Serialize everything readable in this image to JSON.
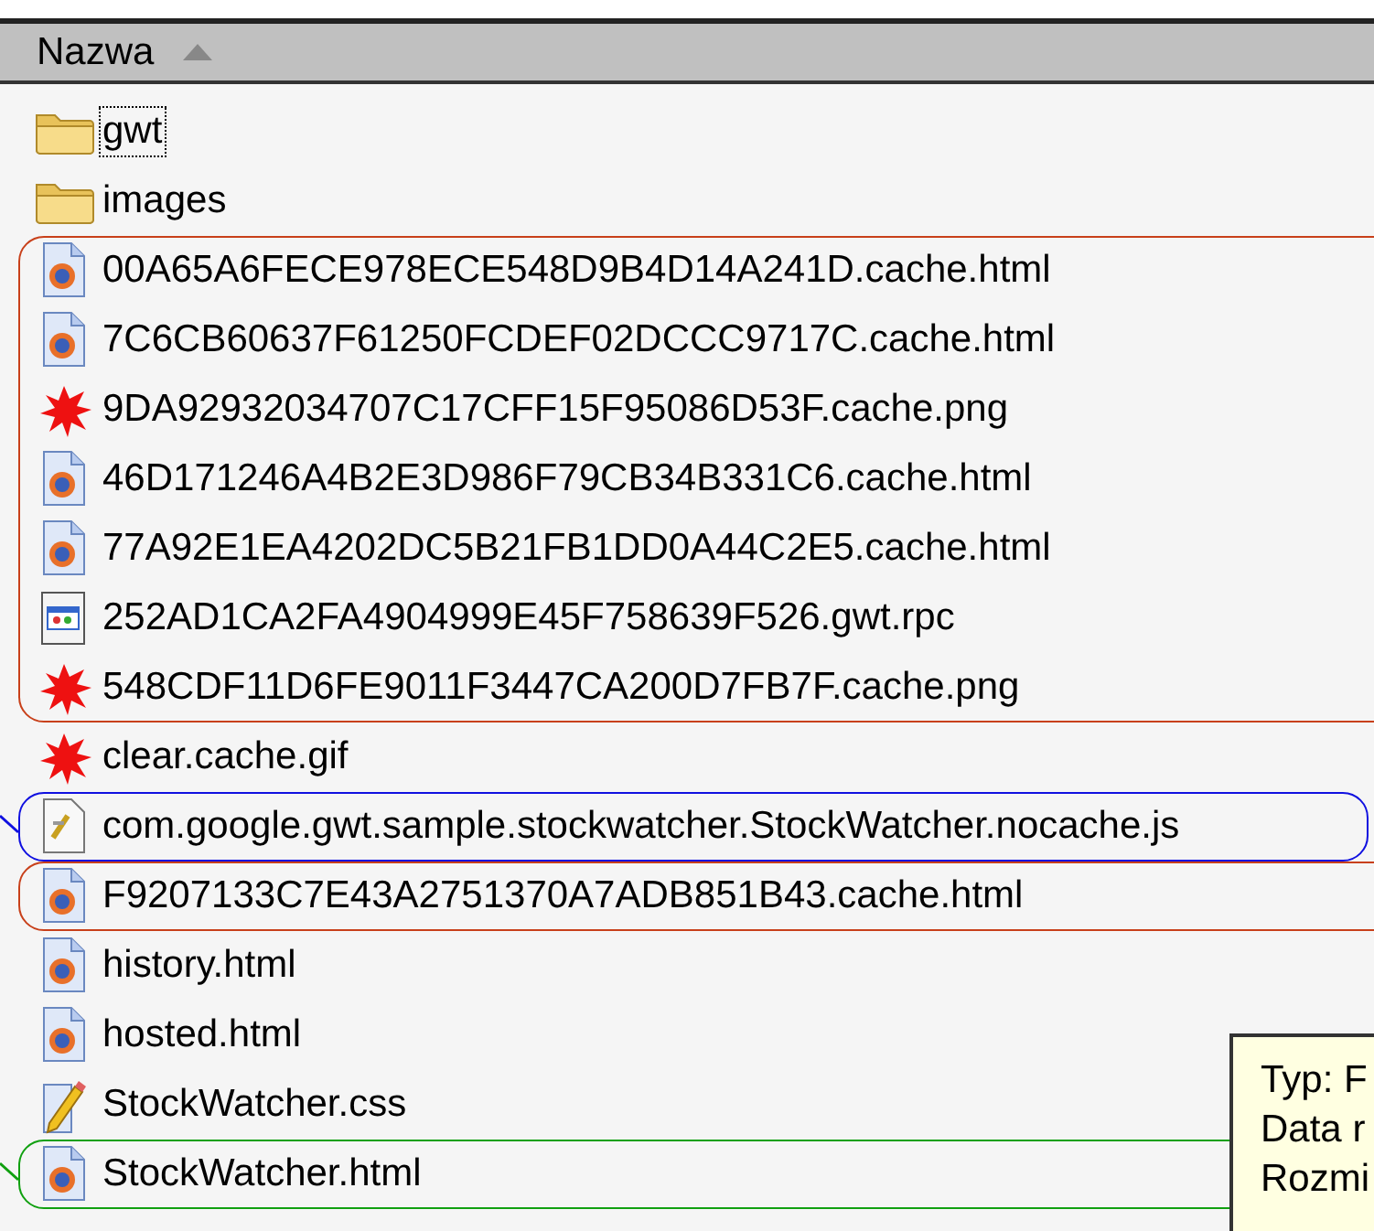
{
  "header": {
    "column": "Nazwa"
  },
  "rows": [
    {
      "kind": "folder",
      "name": "gwt",
      "focused": true
    },
    {
      "kind": "folder",
      "name": "images",
      "focused": false
    },
    {
      "kind": "group",
      "color": "#c8401a",
      "leader": false,
      "open_right": true,
      "children": [
        {
          "kind": "html",
          "name": "00A65A6FECE978ECE548D9B4D14A241D.cache.html",
          "focused": false
        },
        {
          "kind": "html",
          "name": "7C6CB60637F61250FCDEF02DCCC9717C.cache.html",
          "focused": false
        },
        {
          "kind": "image",
          "name": "9DA92932034707C17CFF15F95086D53F.cache.png",
          "focused": false
        },
        {
          "kind": "html",
          "name": "46D171246A4B2E3D986F79CB34B331C6.cache.html",
          "focused": false
        },
        {
          "kind": "html",
          "name": "77A92E1EA4202DC5B21FB1DD0A44C2E5.cache.html",
          "focused": false
        },
        {
          "kind": "rpc",
          "name": "252AD1CA2FA4904999E45F758639F526.gwt.rpc",
          "focused": false
        },
        {
          "kind": "image",
          "name": "548CDF11D6FE9011F3447CA200D7FB7F.cache.png",
          "focused": false
        }
      ]
    },
    {
      "kind": "image",
      "name": "clear.cache.gif",
      "focused": false
    },
    {
      "kind": "group",
      "color": "#1010e0",
      "leader": true,
      "open_right": false,
      "children": [
        {
          "kind": "script",
          "name": "com.google.gwt.sample.stockwatcher.StockWatcher.nocache.js",
          "focused": false
        }
      ]
    },
    {
      "kind": "group",
      "color": "#c8401a",
      "leader": false,
      "open_right": true,
      "children": [
        {
          "kind": "html",
          "name": "F9207133C7E43A2751370A7ADB851B43.cache.html",
          "focused": false
        }
      ]
    },
    {
      "kind": "html",
      "name": "history.html",
      "focused": false
    },
    {
      "kind": "html",
      "name": "hosted.html",
      "focused": false
    },
    {
      "kind": "css",
      "name": "StockWatcher.css",
      "focused": false
    },
    {
      "kind": "group",
      "color": "#10a010",
      "leader": true,
      "open_right": true,
      "children": [
        {
          "kind": "html",
          "name": "StockWatcher.html",
          "focused": false
        }
      ]
    }
  ],
  "tooltip": {
    "lines": [
      "Typ: F",
      "Data r",
      "Rozmi"
    ]
  }
}
